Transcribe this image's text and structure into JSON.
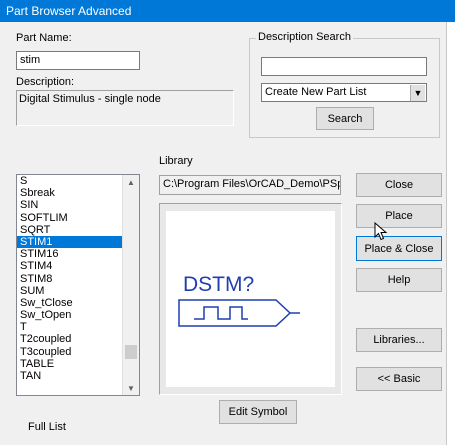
{
  "window": {
    "title": "Part Browser Advanced"
  },
  "part_name": {
    "label": "Part Name:",
    "value": "stim"
  },
  "description": {
    "label": "Description:",
    "value": "Digital Stimulus - single node"
  },
  "description_search": {
    "title": "Description Search",
    "input_value": "",
    "dropdown_value": "Create New Part List",
    "search_button": "Search"
  },
  "library": {
    "label": "Library",
    "path": "C:\\Program Files\\OrCAD_Demo\\PSpic"
  },
  "parts": [
    "S",
    "Sbreak",
    "SIN",
    "SOFTLIM",
    "SQRT",
    "STIM1",
    "STIM16",
    "STIM4",
    "STIM8",
    "SUM",
    "Sw_tClose",
    "Sw_tOpen",
    "T",
    "T2coupled",
    "T3coupled",
    "TABLE",
    "TAN"
  ],
  "selected_part": "STIM1",
  "symbol": {
    "text": "DSTM?",
    "color": "#1f3fb0"
  },
  "buttons": {
    "close": "Close",
    "place": "Place",
    "place_close": "Place & Close",
    "help": "Help",
    "libraries": "Libraries...",
    "basic": "<< Basic",
    "edit_symbol": "Edit Symbol"
  },
  "full_list_label": "Full List"
}
